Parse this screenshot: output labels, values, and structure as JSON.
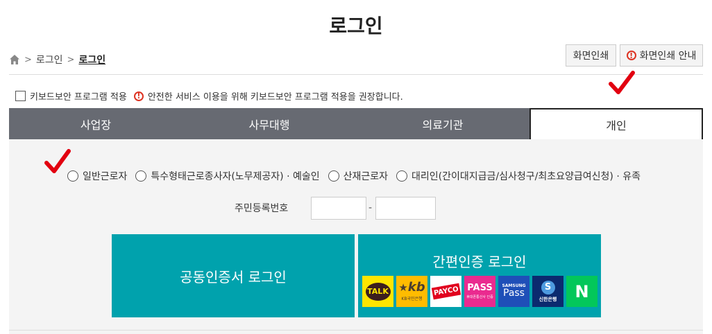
{
  "page": {
    "title": "로그인"
  },
  "breadcrumb": {
    "items": [
      "로그인",
      "로그인"
    ]
  },
  "print": {
    "print_label": "화면인쇄",
    "guide_label": "화면인쇄 안내"
  },
  "keyboard": {
    "label": "키보드보안 프로그램 적용",
    "notice": "안전한 서비스 이용을 위해 키보드보안 프로그램 적용을 권장합니다."
  },
  "tabs": [
    {
      "label": "사업장",
      "active": false
    },
    {
      "label": "사무대행",
      "active": false
    },
    {
      "label": "의료기관",
      "active": false
    },
    {
      "label": "개인",
      "active": true
    }
  ],
  "user_types": [
    "일반근로자",
    "특수형태근로종사자(노무제공자) · 예술인",
    "산재근로자",
    "대리인(간이대지급금/심사청구/최초요양급여신청) · 유족"
  ],
  "ssn": {
    "label": "주민등록번호",
    "separator": "-"
  },
  "cert_login": {
    "label": "공동인증서 로그인"
  },
  "easy_login": {
    "title": "간편인증 로그인",
    "providers": [
      {
        "name": "TALK",
        "sub": "",
        "icon": "kakao-icon",
        "bg": "#fee500",
        "fg": "#3c1e1e"
      },
      {
        "name": "kb",
        "sub": "KB국민은행",
        "icon": "kb-icon",
        "bg": "#ffbc00",
        "fg": "#4b3e30"
      },
      {
        "name": "PAYCO",
        "sub": "",
        "icon": "payco-icon",
        "bg": "#ffffff",
        "fg": "#e1001e"
      },
      {
        "name": "PASS",
        "sub": "휴대폰통신사 인증",
        "icon": "pass-icon",
        "bg": "#ea2a8f",
        "fg": "#ffffff"
      },
      {
        "name": "Pass",
        "sub": "SAMSUNG",
        "icon": "samsung-pass-icon",
        "bg": "#1f4fb8",
        "fg": "#ffffff"
      },
      {
        "name": "S",
        "sub": "신한은행",
        "icon": "shinhan-icon",
        "bg": "#0b2a6f",
        "fg": "#ffffff"
      },
      {
        "name": "N",
        "sub": "",
        "icon": "naver-icon",
        "bg": "#03c75a",
        "fg": "#ffffff"
      }
    ]
  },
  "colors": {
    "tab_bg": "#676a72",
    "accent": "#00a2ad",
    "annotation": "#e20010"
  }
}
